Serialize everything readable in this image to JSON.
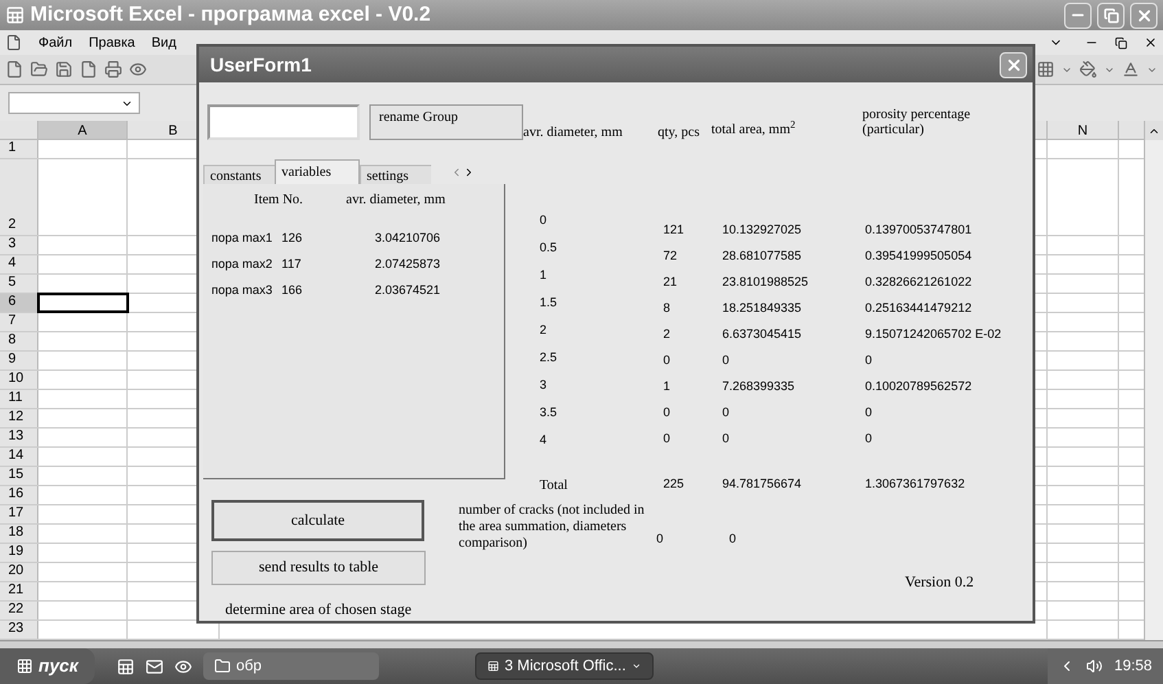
{
  "excel": {
    "title": "Microsoft Excel - программа excel - V0.2",
    "menu": [
      "Файл",
      "Правка",
      "Вид"
    ],
    "columns": [
      {
        "label": "A",
        "selected": true
      },
      {
        "label": "B",
        "selected": false
      },
      {
        "label": "N",
        "selected": false
      }
    ],
    "rows": [
      {
        "label": "1",
        "selected": false
      },
      {
        "label": "2",
        "selected": false
      },
      {
        "label": "3",
        "selected": false
      },
      {
        "label": "4",
        "selected": false
      },
      {
        "label": "5",
        "selected": false
      },
      {
        "label": "6",
        "selected": true
      },
      {
        "label": "7",
        "selected": false
      },
      {
        "label": "8",
        "selected": false
      },
      {
        "label": "9",
        "selected": false
      },
      {
        "label": "10",
        "selected": false
      },
      {
        "label": "11",
        "selected": false
      },
      {
        "label": "12",
        "selected": false
      },
      {
        "label": "13",
        "selected": false
      },
      {
        "label": "14",
        "selected": false
      },
      {
        "label": "15",
        "selected": false
      },
      {
        "label": "16",
        "selected": false
      },
      {
        "label": "17",
        "selected": false
      },
      {
        "label": "18",
        "selected": false
      },
      {
        "label": "19",
        "selected": false
      },
      {
        "label": "20",
        "selected": false
      },
      {
        "label": "21",
        "selected": false
      },
      {
        "label": "22",
        "selected": false
      },
      {
        "label": "23",
        "selected": false
      }
    ]
  },
  "form": {
    "title": "UserForm1",
    "rename_button": "rename Group",
    "headers": [
      "avr. diameter, mm",
      "qty, pcs",
      "total area, mm$^{2}$",
      "porosity percentage (particular)"
    ],
    "tabs": [
      {
        "label": "constants",
        "selected": false
      },
      {
        "label": "variables",
        "selected": true
      },
      {
        "label": "settings",
        "selected": false
      }
    ],
    "tab_headers": [
      "Item No.",
      "avr. diameter, mm"
    ],
    "items": [
      {
        "name": "пора max1",
        "number": "126",
        "diameter": "3.04210706"
      },
      {
        "name": "пора max2",
        "number": "117",
        "diameter": "2.07425873"
      },
      {
        "name": "пора max3",
        "number": "166",
        "diameter": "2.03674521"
      }
    ],
    "diameters": [
      "0",
      "0.5",
      "1",
      "1.5",
      "2",
      "2.5",
      "3",
      "3.5",
      "4"
    ],
    "rows": [
      {
        "qty": "121",
        "area": "10.132927025",
        "porosity": "0.13970053747801"
      },
      {
        "qty": "72",
        "area": "28.681077585",
        "porosity": "0.39541999505054"
      },
      {
        "qty": "21",
        "area": "23.8101988525",
        "porosity": "0.32826621261022"
      },
      {
        "qty": "8",
        "area": "18.251849335",
        "porosity": "0.25163441479212"
      },
      {
        "qty": "2",
        "area": "6.6373045415",
        "porosity": "9.15071242065702 E-02"
      },
      {
        "qty": "0",
        "area": "0",
        "porosity": "0"
      },
      {
        "qty": "1",
        "area": "7.268399335",
        "porosity": "0.10020789562572"
      },
      {
        "qty": "0",
        "area": "0",
        "porosity": "0"
      },
      {
        "qty": "0",
        "area": "0",
        "porosity": "0"
      }
    ],
    "total": {
      "label": "Total",
      "qty": "225",
      "area": "94.781756674",
      "porosity": "1.3067361797632"
    },
    "buttons": [
      "calculate",
      "send results to table"
    ],
    "caption": "determine area of chosen stage",
    "cracks": {
      "label": "number of cracks (not included in the area summation, diameters comparison)",
      "qty": "0",
      "area": "0"
    },
    "version": "Version 0.2"
  },
  "taskbar": {
    "start": "пуск",
    "items": [
      {
        "kind": "folder",
        "label": "обр",
        "selected": false
      },
      {
        "kind": "excel",
        "label": "3 Microsoft Offic...",
        "selected": true
      }
    ],
    "clock": "19:58"
  }
}
